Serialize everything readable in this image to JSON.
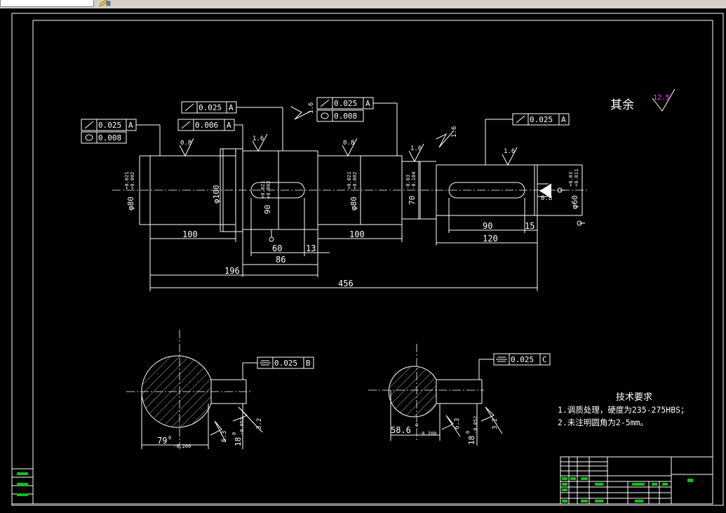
{
  "colors": {
    "background": "#000000",
    "lines": "#ffffff",
    "roughness_note": "#ff33ff",
    "title_block_fill": "#11c011"
  },
  "icons": {
    "toolbar": "pencil-icon"
  },
  "gdt": [
    {
      "value": "0.025",
      "datum": "A"
    },
    {
      "value": "0.008"
    },
    {
      "value": "0.025",
      "datum": "A"
    },
    {
      "value": "0.006",
      "datum": "A"
    },
    {
      "value": "0.025",
      "datum": "A"
    },
    {
      "value": "0.008"
    },
    {
      "value": "0.025",
      "datum": "A"
    },
    {
      "value": "0.025",
      "datum": "B"
    },
    {
      "value": "0.025",
      "datum": "C"
    }
  ],
  "roughness": {
    "r1": "0.8",
    "r2": "1.6",
    "r3": "1.6",
    "r4": "0.8",
    "r5": "1.6",
    "r6": "1.6",
    "r7": "1.6",
    "r8": "0.8",
    "r9": "3.2",
    "r10": "6.3",
    "r11": "3.2",
    "r12": "6.3",
    "r13": "1.6"
  },
  "general_roughness": {
    "label": "其余",
    "value": "12.5"
  },
  "diameters": {
    "d1": {
      "text": "φ80",
      "upper": "+0.021",
      "lower": "+0.002"
    },
    "d2": {
      "text": "φ100"
    },
    "d3": {
      "text": "90",
      "upper": "+0.021",
      "lower": "+0.002"
    },
    "d4": {
      "text": "φ80",
      "upper": "+0.021",
      "lower": "+0.002"
    },
    "d5": {
      "text": "70",
      "upper": "-0.03",
      "lower": "-0.104"
    },
    "d6": {
      "text": "φ60",
      "upper": "+0.03",
      "lower": "+0.011"
    }
  },
  "lengths": {
    "l100a": "100",
    "l60": "60",
    "l13": "13",
    "l100b": "100",
    "l86": "86",
    "l196": "196",
    "l456": "456",
    "l90": "90",
    "l15": "15",
    "l120": "120"
  },
  "sections": {
    "s1": {
      "width": "79",
      "w_upper": "0",
      "w_lower": "-0.200",
      "key": "18",
      "k_upper": "0",
      "k_lower": "-0.052"
    },
    "s2": {
      "width": "58.6",
      "w_upper": "0",
      "w_lower": "-0.200",
      "key": "18",
      "k_upper": "0",
      "k_lower": "-0.052"
    }
  },
  "notes": {
    "title": "技术要求",
    "line1": "1.调质处理，硬度为235-275HBS；",
    "line2": "2.未注明圆角为2-5mm。"
  }
}
